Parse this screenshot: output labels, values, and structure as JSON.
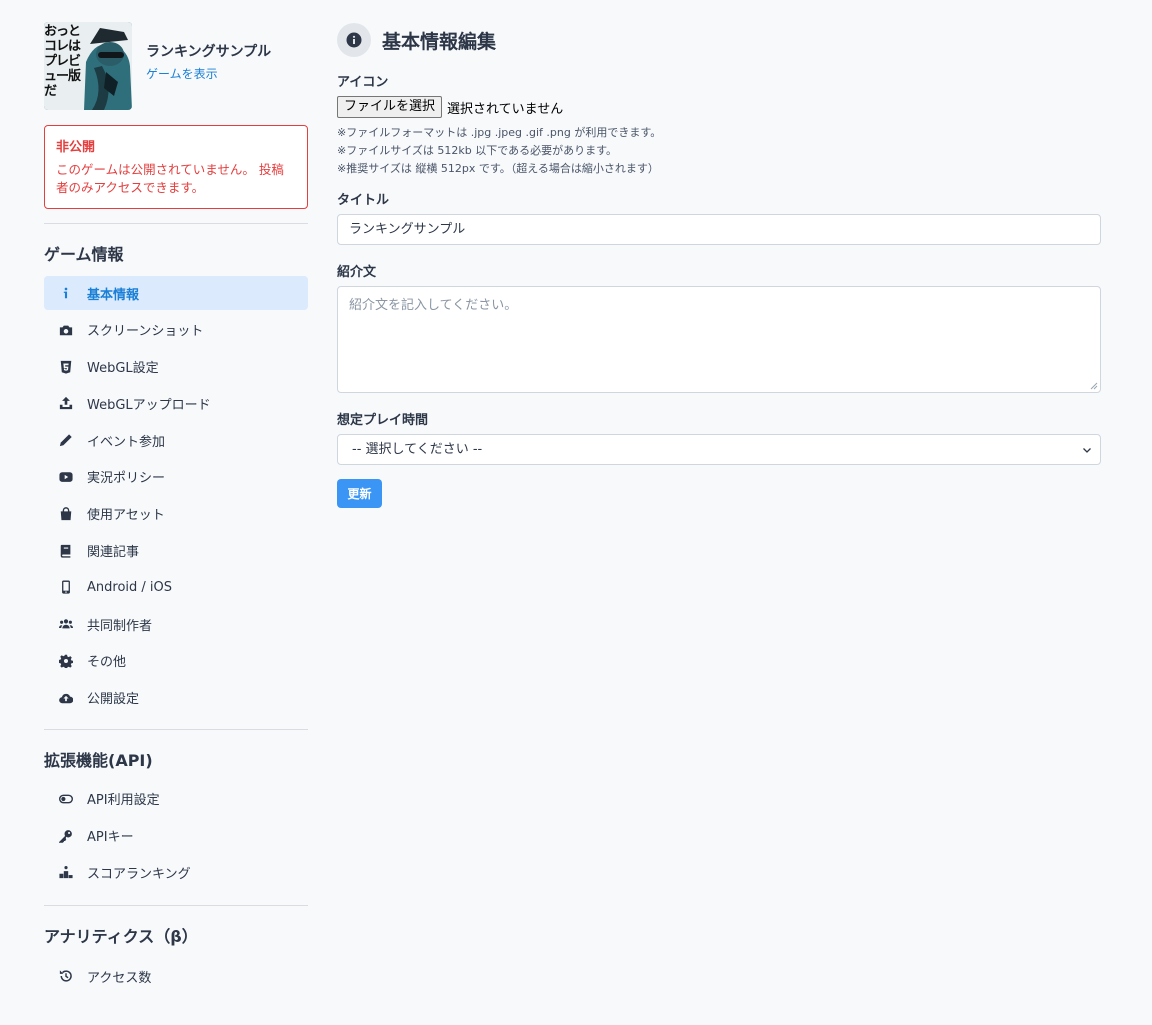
{
  "game": {
    "thumbnail_text": "おっとコレはプレビュー版だ",
    "name": "ランキングサンプル",
    "view_link": "ゲームを表示"
  },
  "alert": {
    "title": "非公開",
    "body": "このゲームは公開されていません。 投稿者のみアクセスできます。"
  },
  "sidebar": {
    "sections": [
      {
        "title": "ゲーム情報",
        "items": [
          {
            "label": "基本情報",
            "icon": "info-icon",
            "active": true
          },
          {
            "label": "スクリーンショット",
            "icon": "camera-icon"
          },
          {
            "label": "WebGL設定",
            "icon": "html5-icon"
          },
          {
            "label": "WebGLアップロード",
            "icon": "upload-icon"
          },
          {
            "label": "イベント参加",
            "icon": "pen-icon"
          },
          {
            "label": "実況ポリシー",
            "icon": "youtube-icon"
          },
          {
            "label": "使用アセット",
            "icon": "shopping-bag-icon"
          },
          {
            "label": "関連記事",
            "icon": "book-icon"
          },
          {
            "label": "Android / iOS",
            "icon": "mobile-icon"
          },
          {
            "label": "共同制作者",
            "icon": "users-icon"
          },
          {
            "label": "その他",
            "icon": "gear-icon"
          },
          {
            "label": "公開設定",
            "icon": "cloud-upload-icon"
          }
        ]
      },
      {
        "title": "拡張機能(API)",
        "items": [
          {
            "label": "API利用設定",
            "icon": "toggle-icon"
          },
          {
            "label": "APIキー",
            "icon": "key-icon"
          },
          {
            "label": "スコアランキング",
            "icon": "podium-icon"
          }
        ]
      },
      {
        "title": "アナリティクス（β）",
        "items": [
          {
            "label": "アクセス数",
            "icon": "history-icon"
          }
        ]
      }
    ]
  },
  "main": {
    "title": "基本情報編集",
    "icon_field": {
      "label": "アイコン",
      "button": "ファイルを選択",
      "status": "選択されていません",
      "hints": [
        "※ファイルフォーマットは .jpg .jpeg .gif .png が利用できます。",
        "※ファイルサイズは 512kb 以下である必要があります。",
        "※推奨サイズは 縦横 512px です。（超える場合は縮小されます）"
      ]
    },
    "title_field": {
      "label": "タイトル",
      "value": "ランキングサンプル"
    },
    "description_field": {
      "label": "紹介文",
      "placeholder": "紹介文を記入してください。"
    },
    "playtime_field": {
      "label": "想定プレイ時間",
      "selected": "-- 選択してください --"
    },
    "submit": "更新"
  },
  "colors": {
    "accent": "#1a7fd6",
    "button": "#3b95f5",
    "danger": "#e53e3e",
    "active_bg": "#dbeafd"
  }
}
